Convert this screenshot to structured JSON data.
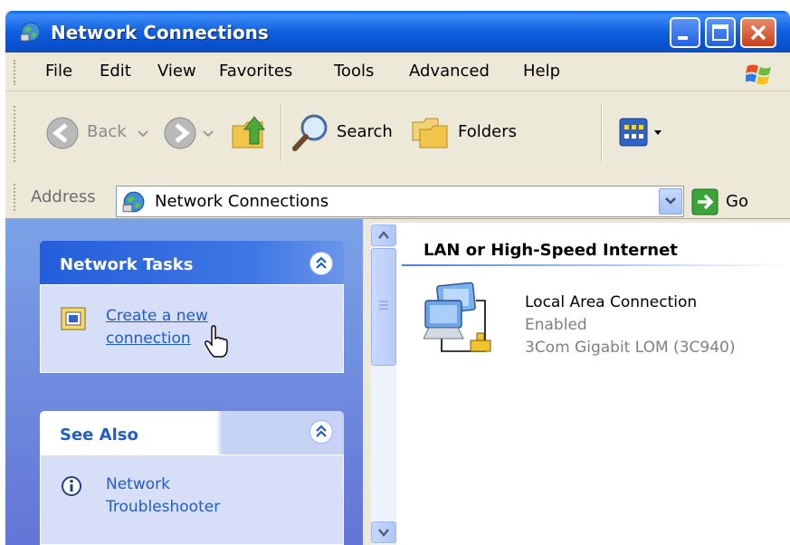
{
  "window": {
    "title": "Network Connections",
    "title_icon": "network-connections-icon"
  },
  "menu": {
    "items": [
      "File",
      "Edit",
      "View",
      "Favorites",
      "Tools",
      "Advanced",
      "Help"
    ]
  },
  "toolbar": {
    "back_label": "Back",
    "search_label": "Search",
    "folders_label": "Folders"
  },
  "address": {
    "label": "Address",
    "value": "Network Connections",
    "go_label": "Go"
  },
  "sidebar": {
    "network_tasks": {
      "title": "Network Tasks",
      "link_line1": "Create a new",
      "link_line2": "connection"
    },
    "see_also": {
      "title": "See Also",
      "item_line1": "Network",
      "item_line2": "Troubleshooter"
    }
  },
  "content": {
    "group_title": "LAN or High-Speed Internet",
    "connection": {
      "name": "Local Area Connection",
      "status": "Enabled",
      "device": "3Com Gigabit LOM (3C940)"
    }
  },
  "colors": {
    "titlebar": "#0a52d0",
    "sidebar": "#7ba2e7",
    "link": "#215dc6",
    "panel_head": "#215dc6"
  }
}
